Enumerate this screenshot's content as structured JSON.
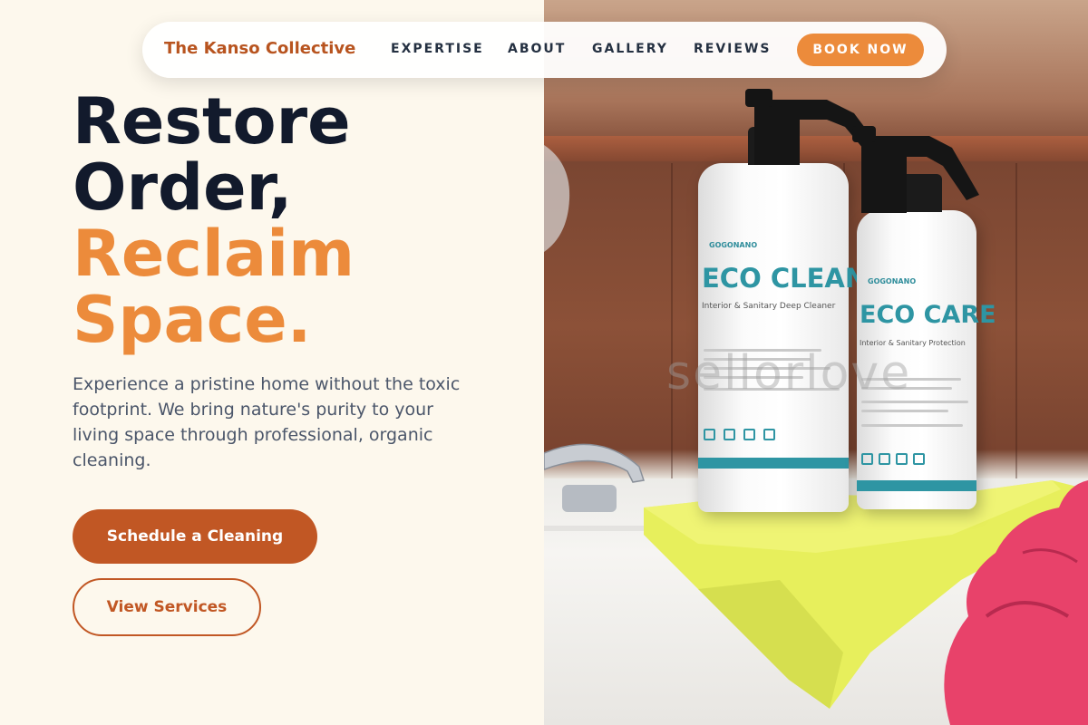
{
  "nav": {
    "brand": "The Kanso Collective",
    "links": [
      "EXPERTISE",
      "ABOUT",
      "GALLERY",
      "REVIEWS"
    ],
    "cta": "BOOK NOW"
  },
  "hero": {
    "headline_dark": [
      "Restore",
      "Order,"
    ],
    "headline_accent": [
      "Reclaim",
      "Space."
    ],
    "description": "Experience a pristine home without the toxic footprint. We bring nature's purity to your living space through professional, organic cleaning.",
    "primary_button": "Schedule a Cleaning",
    "secondary_button": "View Services"
  },
  "photo": {
    "bottle_left": {
      "brand": "GOGONANO",
      "title": "ECO CLEAN",
      "subtitle": "Interior & Sanitary Deep Cleaner"
    },
    "bottle_right": {
      "brand": "GOGONANO",
      "title": "ECO CARE",
      "subtitle": "Interior & Sanitary Protection"
    },
    "watermark": "sellorlove"
  },
  "colors": {
    "brand": "#b8541f",
    "accent": "#ec8b3b",
    "primary_button": "#c15724",
    "headline": "#121a2c",
    "background": "#fdf8ed"
  }
}
